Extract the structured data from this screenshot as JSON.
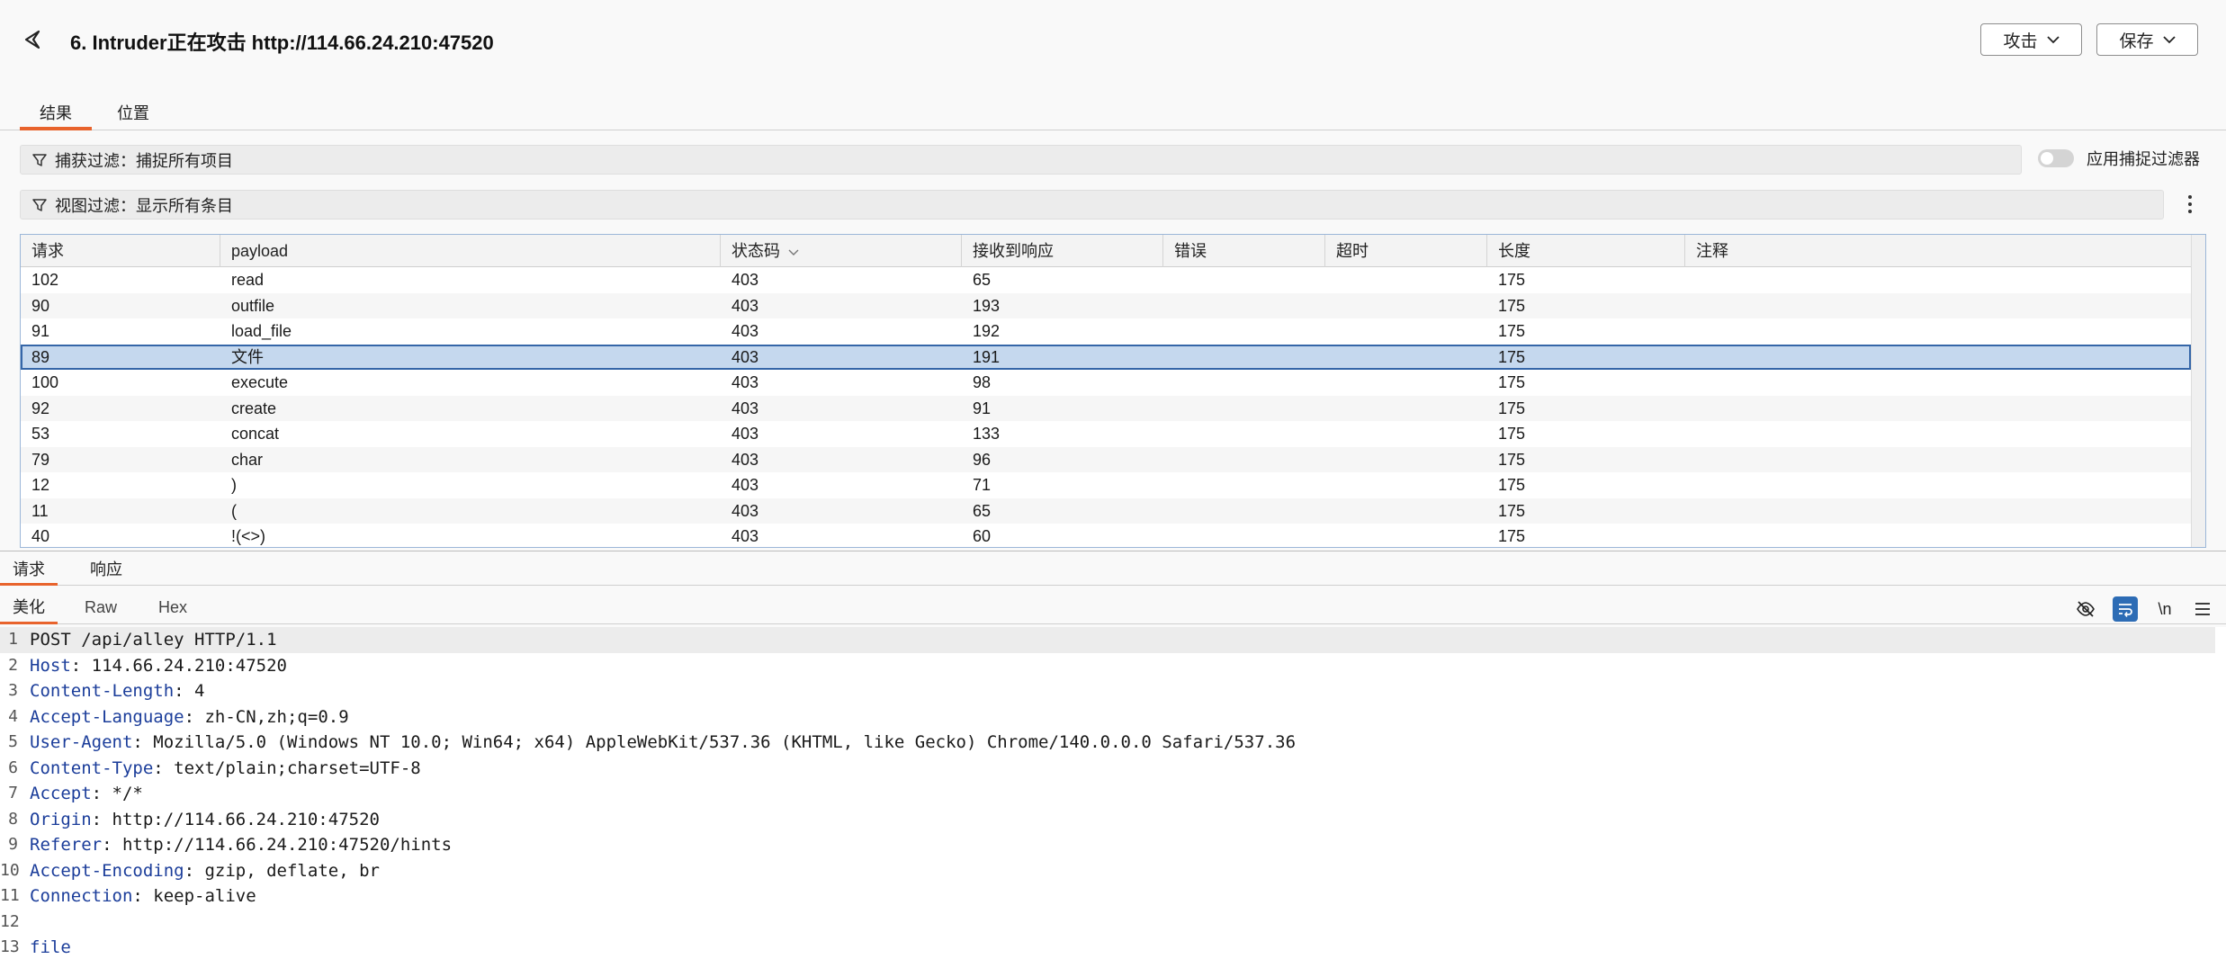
{
  "header": {
    "title": "6. Intruder正在攻击 http://114.66.24.210:47520",
    "attack_label": "攻击",
    "save_label": "保存"
  },
  "tabs": [
    {
      "label": "结果",
      "active": true
    },
    {
      "label": "位置",
      "active": false
    }
  ],
  "filters": {
    "capture": "捕获过滤：捕捉所有项目",
    "view": "视图过滤：显示所有条目",
    "apply_capture_label": "应用捕捉过滤器"
  },
  "table": {
    "columns": [
      "请求",
      "payload",
      "状态码",
      "接收到响应",
      "错误",
      "超时",
      "长度",
      "注释"
    ],
    "sorted_column": "状态码",
    "rows": [
      {
        "req": "102",
        "payload": "read",
        "status": "403",
        "resp": "65",
        "error": "",
        "timeout": "",
        "length": "175",
        "comment": ""
      },
      {
        "req": "90",
        "payload": "outfile",
        "status": "403",
        "resp": "193",
        "error": "",
        "timeout": "",
        "length": "175",
        "comment": ""
      },
      {
        "req": "91",
        "payload": "load_file",
        "status": "403",
        "resp": "192",
        "error": "",
        "timeout": "",
        "length": "175",
        "comment": ""
      },
      {
        "req": "89",
        "payload": "文件",
        "status": "403",
        "resp": "191",
        "error": "",
        "timeout": "",
        "length": "175",
        "comment": "",
        "selected": true
      },
      {
        "req": "100",
        "payload": "execute",
        "status": "403",
        "resp": "98",
        "error": "",
        "timeout": "",
        "length": "175",
        "comment": ""
      },
      {
        "req": "92",
        "payload": "create",
        "status": "403",
        "resp": "91",
        "error": "",
        "timeout": "",
        "length": "175",
        "comment": ""
      },
      {
        "req": "53",
        "payload": "concat",
        "status": "403",
        "resp": "133",
        "error": "",
        "timeout": "",
        "length": "175",
        "comment": ""
      },
      {
        "req": "79",
        "payload": "char",
        "status": "403",
        "resp": "96",
        "error": "",
        "timeout": "",
        "length": "175",
        "comment": ""
      },
      {
        "req": "12",
        "payload": ")",
        "status": "403",
        "resp": "71",
        "error": "",
        "timeout": "",
        "length": "175",
        "comment": ""
      },
      {
        "req": "11",
        "payload": "(",
        "status": "403",
        "resp": "65",
        "error": "",
        "timeout": "",
        "length": "175",
        "comment": ""
      },
      {
        "req": "40",
        "payload": "!(<>)",
        "status": "403",
        "resp": "60",
        "error": "",
        "timeout": "",
        "length": "175",
        "comment": ""
      }
    ]
  },
  "subtabs": [
    {
      "label": "请求",
      "active": true
    },
    {
      "label": "响应",
      "active": false
    }
  ],
  "viewtabs": [
    {
      "label": "美化",
      "active": true
    },
    {
      "label": "Raw",
      "active": false
    },
    {
      "label": "Hex",
      "active": false
    }
  ],
  "toolbar": {
    "newline_label": "\\n"
  },
  "editor": {
    "lines": [
      {
        "n": "1",
        "name": "",
        "value": "POST /api/alley HTTP/1.1"
      },
      {
        "n": "2",
        "name": "Host",
        "value": "114.66.24.210:47520"
      },
      {
        "n": "3",
        "name": "Content-Length",
        "value": "4"
      },
      {
        "n": "4",
        "name": "Accept-Language",
        "value": "zh-CN,zh;q=0.9"
      },
      {
        "n": "5",
        "name": "User-Agent",
        "value": "Mozilla/5.0 (Windows NT 10.0; Win64; x64) AppleWebKit/537.36 (KHTML, like Gecko) Chrome/140.0.0.0 Safari/537.36"
      },
      {
        "n": "6",
        "name": "Content-Type",
        "value": "text/plain;charset=UTF-8"
      },
      {
        "n": "7",
        "name": "Accept",
        "value": "*/*"
      },
      {
        "n": "8",
        "name": "Origin",
        "value": "http://114.66.24.210:47520"
      },
      {
        "n": "9",
        "name": "Referer",
        "value": "http://114.66.24.210:47520/hints"
      },
      {
        "n": "10",
        "name": "Accept-Encoding",
        "value": "gzip, deflate, br"
      },
      {
        "n": "11",
        "name": "Connection",
        "value": "keep-alive"
      },
      {
        "n": "12",
        "name": "",
        "value": ""
      },
      {
        "n": "13",
        "name": "",
        "value": "file",
        "body": true
      }
    ]
  },
  "colors": {
    "accent": "#e8632c",
    "selected_row": "#c5d8ee",
    "header_name": "#1b3d9a"
  }
}
